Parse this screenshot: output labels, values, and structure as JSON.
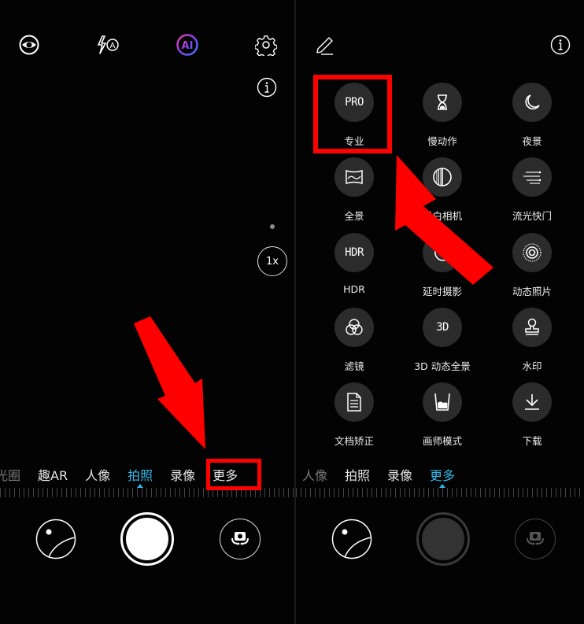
{
  "left_screen": {
    "top_bar": {
      "icons": [
        "beauty-eye-icon",
        "flash-auto-icon",
        "ai-icon",
        "settings-gear-icon"
      ],
      "flash_label": "A",
      "ai_label": "AI"
    },
    "info_icon": "info-icon",
    "zoom_label": "1x",
    "modes": [
      {
        "label": "光圈",
        "state": "dim"
      },
      {
        "label": "趣AR",
        "state": "normal"
      },
      {
        "label": "人像",
        "state": "normal"
      },
      {
        "label": "拍照",
        "state": "active"
      },
      {
        "label": "录像",
        "state": "normal"
      },
      {
        "label": "更多",
        "state": "normal"
      }
    ],
    "bottom": {
      "gallery": "gallery-icon",
      "shutter": "shutter-button",
      "switch_camera": "switch-camera-icon"
    }
  },
  "right_screen": {
    "top_bar": {
      "edit_icon": "edit-pencil-icon",
      "info_icon": "info-icon"
    },
    "mode_grid": [
      {
        "label": "专业",
        "icon": "pro-icon",
        "glyph": "PRO"
      },
      {
        "label": "慢动作",
        "icon": "hourglass-icon",
        "glyph": ""
      },
      {
        "label": "夜景",
        "icon": "moon-icon",
        "glyph": ""
      },
      {
        "label": "全景",
        "icon": "panorama-icon",
        "glyph": ""
      },
      {
        "label": "黑白相机",
        "icon": "monochrome-icon",
        "glyph": ""
      },
      {
        "label": "流光快门",
        "icon": "light-trail-icon",
        "glyph": ""
      },
      {
        "label": "HDR",
        "icon": "hdr-icon",
        "glyph": "HDR"
      },
      {
        "label": "延时摄影",
        "icon": "timelapse-icon",
        "glyph": ""
      },
      {
        "label": "动态照片",
        "icon": "moving-picture-icon",
        "glyph": ""
      },
      {
        "label": "滤镜",
        "icon": "filter-icon",
        "glyph": ""
      },
      {
        "label": "3D 动态全景",
        "icon": "3d-panorama-icon",
        "glyph": "3D"
      },
      {
        "label": "水印",
        "icon": "watermark-stamp-icon",
        "glyph": ""
      },
      {
        "label": "文档矫正",
        "icon": "document-icon",
        "glyph": ""
      },
      {
        "label": "画师模式",
        "icon": "artist-cup-icon",
        "glyph": ""
      },
      {
        "label": "下载",
        "icon": "download-icon",
        "glyph": ""
      }
    ],
    "modes": [
      {
        "label": "人像",
        "state": "dim"
      },
      {
        "label": "拍照",
        "state": "normal"
      },
      {
        "label": "录像",
        "state": "normal"
      },
      {
        "label": "更多",
        "state": "active"
      }
    ]
  },
  "annotations": {
    "color": "#ff0000",
    "highlight_left": "更多",
    "highlight_right": "专业"
  },
  "colors": {
    "accent": "#2fb7e8",
    "background": "#030303",
    "icon_circle": "#2b2b2b",
    "ai_gradient": [
      "#e040a0",
      "#7040f0",
      "#3080ff"
    ]
  }
}
